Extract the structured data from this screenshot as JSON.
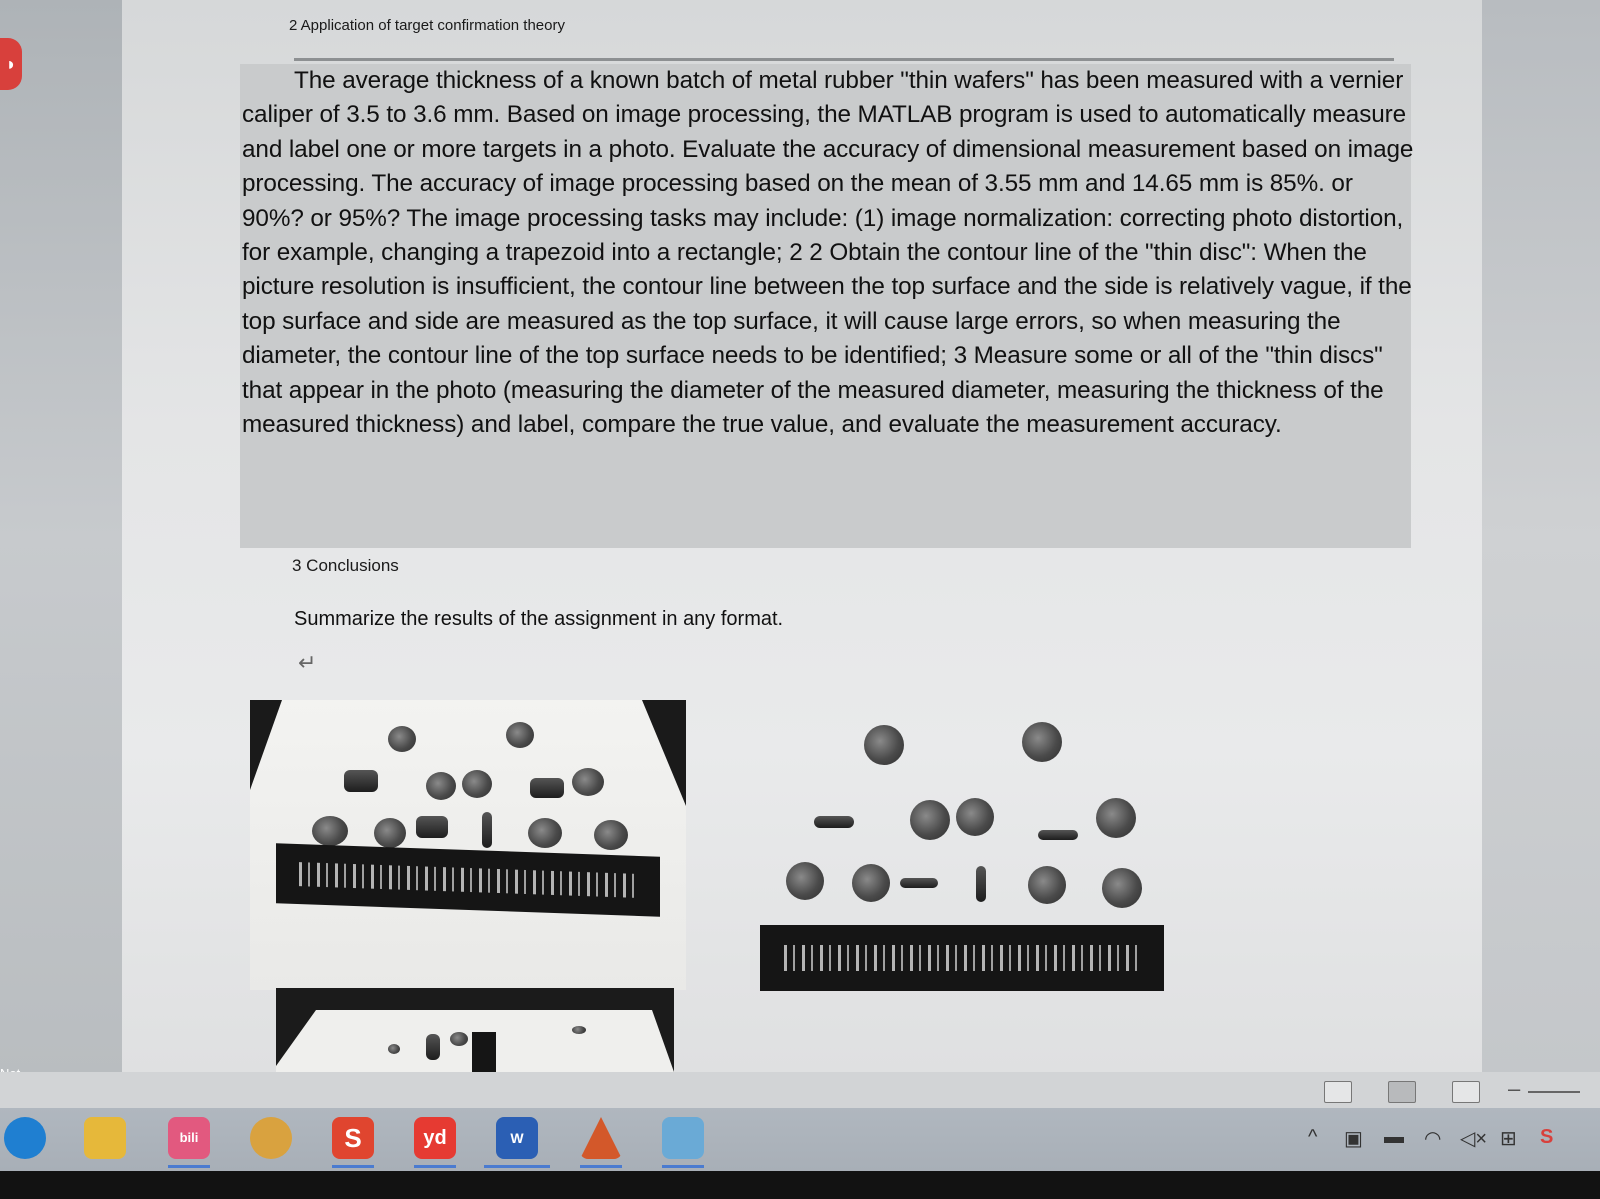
{
  "document": {
    "section2_heading": "2 Application of target confirmation theory",
    "section2_paragraph": "The average thickness of a known batch of metal rubber \"thin wafers\" has been measured with a vernier caliper of 3.5 to 3.6 mm. Based on image processing, the MATLAB program is used to automatically measure and label one or more targets in a photo. Evaluate the accuracy of dimensional measurement based on image processing. The accuracy of image processing based on the mean of 3.55 mm and 14.65 mm is 85%.  or 90%?  or 95%? The image processing tasks may include: (1) image normalization: correcting photo distortion, for example, changing a trapezoid into a rectangle; 2 2 Obtain the contour line of the \"thin disc\": When the picture resolution is insufficient, the contour line between the top surface and the side is relatively vague, if the top surface and side are measured as the top surface, it will cause large errors, so when measuring the diameter, the contour line of the top surface needs to be identified; 3 Measure some or all of the \"thin discs\" that appear in the photo (measuring the diameter of the measured diameter, measuring the thickness of the measured thickness) and label, compare the true value, and evaluate the measurement accuracy.",
    "section3_heading": "3 Conclusions",
    "section3_text": "Summarize the results of the assignment in any format.",
    "return_mark": "↵"
  },
  "side": {
    "not_available": "Not available"
  },
  "taskbar": {
    "apps": [
      {
        "name": "edge-icon",
        "color": "#1f7fd1"
      },
      {
        "name": "file-explorer-icon",
        "color": "#e6b83a"
      },
      {
        "name": "bilibili-icon",
        "color": "#e2597f",
        "label": "bili"
      },
      {
        "name": "browser-app-icon",
        "color": "#d9a23f"
      },
      {
        "name": "sogou-icon",
        "color": "#e0452f",
        "label": "S"
      },
      {
        "name": "youdao-icon",
        "color": "#e63a32",
        "label": "yd"
      },
      {
        "name": "word-icon",
        "color": "#2b5fb4",
        "label": "W"
      },
      {
        "name": "matlab-icon",
        "color": "#d3582a"
      },
      {
        "name": "notes-app-icon",
        "color": "#6aaad6"
      }
    ]
  }
}
